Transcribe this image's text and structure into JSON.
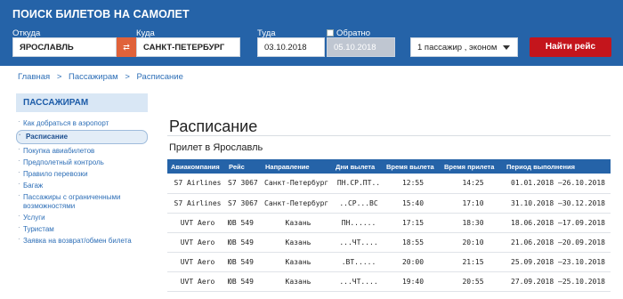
{
  "search": {
    "title": "ПОИСК БИЛЕТОВ НА САМОЛЕТ",
    "from_label": "Откуда",
    "from_value": "ЯРОСЛАВЛЬ",
    "swap_label": "⇄",
    "to_label": "Куда",
    "to_value": "САНКТ-ПЕТЕРБУРГ",
    "depart_label": "Туда",
    "depart_value": "03.10.2018",
    "return_label": "Обратно",
    "return_value": "05.10.2018",
    "passengers_value": "1 пассажир , эконом",
    "find_button": "Найти рейс"
  },
  "breadcrumb": {
    "home": "Главная",
    "sep1": ">",
    "passengers": "Пассажирам",
    "sep2": ">",
    "schedule": "Расписание"
  },
  "sidebar": {
    "title": "ПАССАЖИРАМ",
    "items": [
      "Как добраться в аэропорт",
      "Расписание",
      "Покупка авиабилетов",
      "Предполетный контроль",
      "Правило перевозки",
      "Багаж",
      "Пассажиры с ограниченными возможностями",
      "Услуги",
      "Туристам",
      "Заявка на возврат/обмен билета"
    ]
  },
  "main": {
    "title": "Расписание",
    "subtitle": "Прилет в Ярославль",
    "columns": [
      "Авиакомпания",
      "Рейс",
      "Направление",
      "Дни вылета",
      "Время вылета",
      "Время прилета",
      "Период выполнения"
    ],
    "rows": [
      [
        "S7 Airlines",
        "S7 3067",
        "Санкт-Петербург",
        "ПН.СР.ПТ..",
        "12:55",
        "14:25",
        "01.01.2018 –26.10.2018"
      ],
      [
        "S7 Airlines",
        "S7 3067",
        "Санкт-Петербург",
        "..СР...ВС",
        "15:40",
        "17:10",
        "31.10.2018 –30.12.2018"
      ],
      [
        "UVT Aero",
        "ЮВ 549",
        "Казань",
        "ПН......",
        "17:15",
        "18:30",
        "18.06.2018 –17.09.2018"
      ],
      [
        "UVT Aero",
        "ЮВ 549",
        "Казань",
        "...ЧТ....",
        "18:55",
        "20:10",
        "21.06.2018 –20.09.2018"
      ],
      [
        "UVT Aero",
        "ЮВ 549",
        "Казань",
        ".ВТ.....",
        "20:00",
        "21:15",
        "25.09.2018 –23.10.2018"
      ],
      [
        "UVT Aero",
        "ЮВ 549",
        "Казань",
        "...ЧТ....",
        "19:40",
        "20:55",
        "27.09.2018 –25.10.2018"
      ]
    ]
  }
}
